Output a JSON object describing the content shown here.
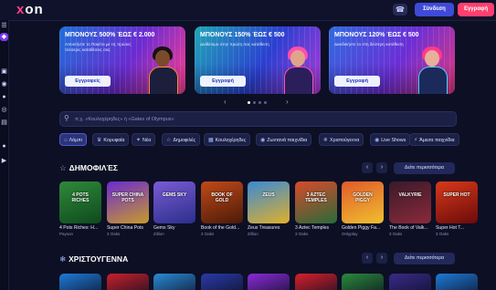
{
  "header": {
    "logo_x": "x",
    "logo_rest": "on",
    "login_label": "Σύνδεση",
    "register_label": "Εγγραφή",
    "support_icon": "headset-icon"
  },
  "sidebar": {
    "icons": [
      "menu-icon",
      "bonus-icon",
      "gift-icon",
      "casino-icon",
      "live-icon",
      "sports-icon",
      "cart-icon",
      "apple-icon",
      "android-icon"
    ]
  },
  "banners": [
    {
      "title": "ΜΠΟΝΟΥΣ 500% ΈΩΣ € 2.000",
      "subtitle": "Αποκτήστε το Πακέτο με τις πρώτες τέσσερις καταθέσεις σας",
      "button": "Εγγραφείς"
    },
    {
      "title": "ΜΠΟΝΟΥΣ 150% ΈΩΣ € 500",
      "subtitle": "Διαθέσιμο στην πρώτη σας κατάθεση",
      "button": "Εγγραφή"
    },
    {
      "title": "ΜΠΟΝΟΥΣ 120% ΈΩΣ € 500",
      "subtitle": "Διεκδικήστε το στη δεύτερη κατάθεση",
      "button": "Εγγραφή"
    }
  ],
  "carousel": {
    "prev": "‹",
    "next": "›",
    "active_index": 0
  },
  "search": {
    "placeholder": "π.χ. «Κουλοχέρηδες» ή «Gates of Olympus»"
  },
  "categories": [
    {
      "label": "Λόμπι",
      "icon": "home-icon",
      "active": true
    },
    {
      "label": "Κορυφαία",
      "icon": "crown-icon"
    },
    {
      "label": "Νέα",
      "icon": "spark-icon"
    },
    {
      "label": "Δημοφιλές",
      "icon": "star-icon"
    },
    {
      "label": "Κουλοχέρηδες",
      "icon": "slots-icon"
    },
    {
      "label": "Ζωντανά παιχνίδια",
      "icon": "live-icon"
    },
    {
      "label": "Χριστούγεννα",
      "icon": "snowflake-icon"
    },
    {
      "label": "Live Shows",
      "icon": "show-icon"
    },
    {
      "label": "Άμεσα παιχνίδια",
      "icon": "lightning-icon"
    }
  ],
  "popular": {
    "title": "ΔΗΜΟΦΙΛΈΣ",
    "see_all": "Δείτε περισσότερα",
    "games": [
      {
        "name": "4 Pots Riches: H...",
        "provider": "Payson",
        "art": "4 POTS RICHES",
        "bg1": "#2f8a3a",
        "bg2": "#0e4a1d"
      },
      {
        "name": "Super China Pots",
        "provider": "3 Oaks",
        "art": "SUPER CHINA POTS",
        "bg1": "#6b2bd1",
        "bg2": "#c89a2a"
      },
      {
        "name": "Gems Sky",
        "provider": "Zillion",
        "art": "GEMS SKY",
        "bg1": "#7b5bd6",
        "bg2": "#2a2f8a"
      },
      {
        "name": "Book of the Gold...",
        "provider": "3 Oaks",
        "art": "BOOK OF GOLD",
        "bg1": "#c24a18",
        "bg2": "#4a1a08"
      },
      {
        "name": "Zeus Treasures",
        "provider": "Zillion",
        "art": "ZEUS",
        "bg1": "#3a8ad6",
        "bg2": "#e0b02a"
      },
      {
        "name": "3 Aztec Temples",
        "provider": "3 Oaks",
        "art": "3 AZTEC TEMPLES",
        "bg1": "#d84a2a",
        "bg2": "#2a6a3a"
      },
      {
        "name": "Golden Piggy Fa...",
        "provider": "Onlyplay",
        "art": "GOLDEN PIGGY",
        "bg1": "#e05a2a",
        "bg2": "#f0c030"
      },
      {
        "name": "The Book of Valk...",
        "provider": "3 Oaks",
        "art": "VALKYRIE",
        "bg1": "#3a1a2a",
        "bg2": "#8a2a3a"
      },
      {
        "name": "Super Hot T...",
        "provider": "3 Oaks",
        "art": "SUPER HOT",
        "bg1": "#d83a1a",
        "bg2": "#6a0a0a"
      }
    ]
  },
  "christmas": {
    "title": "ΧΡΙΣΤΟΥΓΕΝΝΑ",
    "see_all": "Δείτε περισσότερα",
    "tile_colors": [
      "#1e7ad6",
      "#c8202a",
      "#2a8ad6",
      "#2a3aa8",
      "#8a2ad6",
      "#d6202a",
      "#2a8a3a",
      "#3a2a8a",
      "#1e7ad6"
    ]
  },
  "colors": {
    "accent": "#3f4bd8",
    "register": "#ff3f6e",
    "bg": "#0d0f24"
  }
}
